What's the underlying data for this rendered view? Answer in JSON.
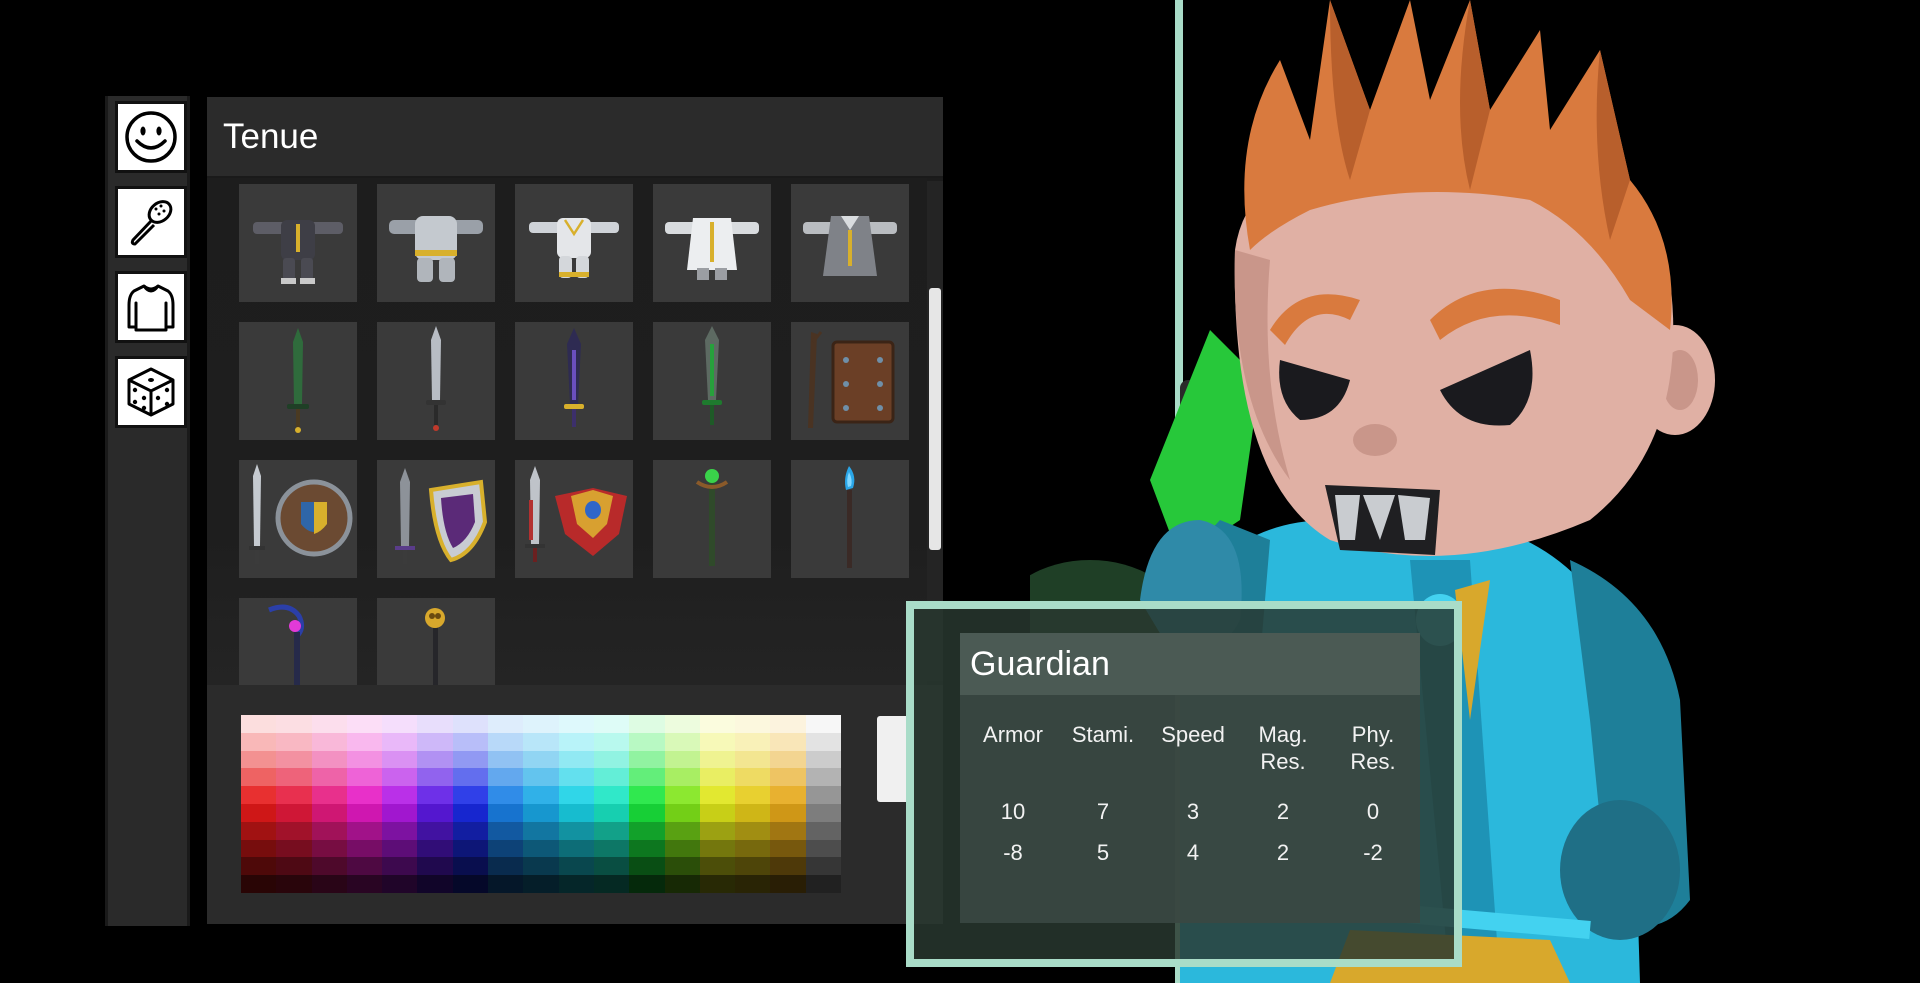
{
  "sidebar": {
    "items": [
      {
        "name": "face",
        "icon": "smiley-face-icon"
      },
      {
        "name": "hair",
        "icon": "hairbrush-icon"
      },
      {
        "name": "outfit",
        "icon": "shirt-icon"
      },
      {
        "name": "random",
        "icon": "dice-icon"
      }
    ]
  },
  "panel": {
    "title": "Tenue",
    "items": [
      {
        "icon": "dark-armor-set-icon"
      },
      {
        "icon": "silver-plate-armor-icon"
      },
      {
        "icon": "light-plate-armor-icon"
      },
      {
        "icon": "white-robe-armor-icon"
      },
      {
        "icon": "grey-coat-armor-icon"
      },
      {
        "icon": "green-sword-icon"
      },
      {
        "icon": "steel-sword-icon"
      },
      {
        "icon": "purple-sword-icon"
      },
      {
        "icon": "emerald-sword-icon"
      },
      {
        "icon": "staff-and-leather-armor-icon"
      },
      {
        "icon": "sword-and-round-shield-icon"
      },
      {
        "icon": "sword-and-purple-shield-icon"
      },
      {
        "icon": "sword-and-red-shield-icon"
      },
      {
        "icon": "green-orb-staff-icon"
      },
      {
        "icon": "blue-flame-staff-icon"
      },
      {
        "icon": "curved-magenta-staff-icon"
      },
      {
        "icon": "golden-orb-staff-icon"
      }
    ],
    "scroll_position": 0.45
  },
  "tooltip": {
    "title": "Guardian",
    "headers": [
      [
        "Armor",
        ""
      ],
      [
        "Stami.",
        ""
      ],
      [
        "Speed",
        ""
      ],
      [
        "Mag.",
        "Res."
      ],
      [
        "Phy.",
        "Res."
      ]
    ],
    "rows": [
      [
        "10",
        "7",
        "3",
        "2",
        "0"
      ],
      [
        "-8",
        "5",
        "4",
        "2",
        "-2"
      ]
    ]
  },
  "colors": {
    "panel_bg": "#2b2b2b",
    "tooltip_border": "#a9dcc8",
    "hair": "#d97a3e",
    "skin": "#e0b0a4",
    "outfit": "#2bb8dc"
  }
}
